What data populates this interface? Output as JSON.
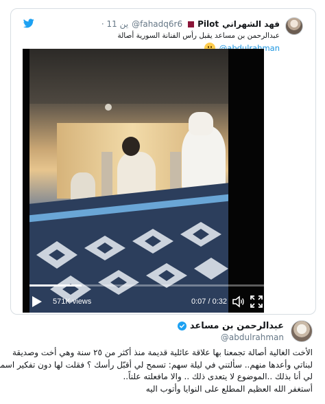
{
  "quoted_tweet": {
    "display_name": "فهد الشهراني",
    "pilot_label": "Pilot",
    "handle": "@fahadq6r6",
    "time": "11 ين",
    "text": "عبدالرحمن بن مساعد يقبل رأس الفنانة السورية أصالة",
    "mention": "@abdulrahman",
    "icons": [
      "twitter-bird-icon",
      "qatar-flag-icon",
      "grinning-face-emoji"
    ]
  },
  "video": {
    "views": "571K views",
    "timecode": "0:07 / 0:32",
    "progress": 0.22,
    "colors": {
      "accent": "#1da1f2",
      "bg": "#000000"
    },
    "icons": [
      "play-icon",
      "volume-icon",
      "fullscreen-icon"
    ]
  },
  "author": {
    "name": "عبدالرحمن بن مساعد",
    "handle": "@abdulrahman",
    "verified_icon": "verified-badge-icon"
  },
  "body_lines": [
    "الأخت الغالية أصالة تجمعنا بها علاقة عائلية قديمة منذ أكثر من ٢٥ سنة وهي أخت وصديقة",
    "لبناتي وأعدها منهم.. سألتني في ليلة سهم: تسمح لي أقبّل رأسك ؟ فقلت لها دون تفكير اسمحي",
    "لي أنا بذلك ..الموضوع لا يتعدى ذلك .. والا مافعلته علناً..",
    "أستغفر الله العظيم المطلع على النوايا وأتوب اليه"
  ]
}
